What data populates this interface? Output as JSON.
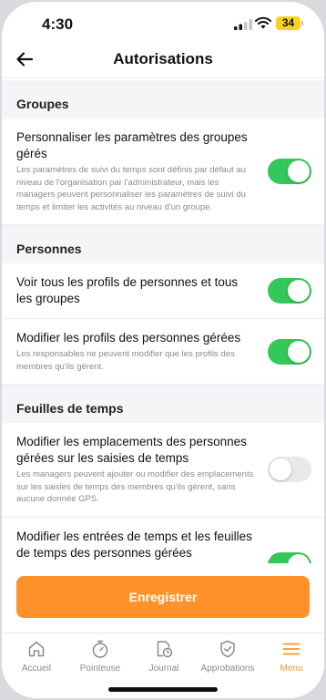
{
  "status_bar": {
    "time": "4:30",
    "battery": "34"
  },
  "header": {
    "title": "Autorisations"
  },
  "sections": [
    {
      "title": "Groupes",
      "items": [
        {
          "title": "Personnaliser les paramètres des groupes gérés",
          "description": "Les paramètres de suivi du temps sont définis par défaut au niveau de l'organisation par l'administrateur, mais les managers peuvent personnaliser les paramètres de suivi du temps et limiter les activités au niveau d'un groupe.",
          "enabled": true
        }
      ]
    },
    {
      "title": "Personnes",
      "items": [
        {
          "title": "Voir tous les profils de personnes et tous les groupes",
          "description": "",
          "enabled": true
        },
        {
          "title": "Modifier les profils des personnes gérées",
          "description": "Les responsables ne peuvent modifier que les profils des membres qu'ils gèrent.",
          "enabled": true
        }
      ]
    },
    {
      "title": "Feuilles de temps",
      "items": [
        {
          "title": "Modifier les emplacements des personnes gérées sur les saisies de temps",
          "description": "Les managers peuvent ajouter ou modifier des emplacements sur les saisies de temps des membres qu'ils gèrent, sans aucune donnée GPS.",
          "enabled": false
        },
        {
          "title": "Modifier les entrées de temps et les feuilles de temps des personnes gérées",
          "description": "",
          "enabled": true
        }
      ]
    }
  ],
  "save_button": "Enregistrer",
  "tabs": [
    {
      "label": "Accueil",
      "icon": "home-icon"
    },
    {
      "label": "Pointeuse",
      "icon": "stopwatch-icon"
    },
    {
      "label": "Journal",
      "icon": "timesheet-icon"
    },
    {
      "label": "Approbations",
      "icon": "shield-check-icon"
    },
    {
      "label": "Menu",
      "icon": "menu-icon",
      "active": true
    }
  ],
  "colors": {
    "accent": "#ff922b",
    "toggle_on": "#34c759",
    "toggle_off": "#e9e9ea"
  }
}
